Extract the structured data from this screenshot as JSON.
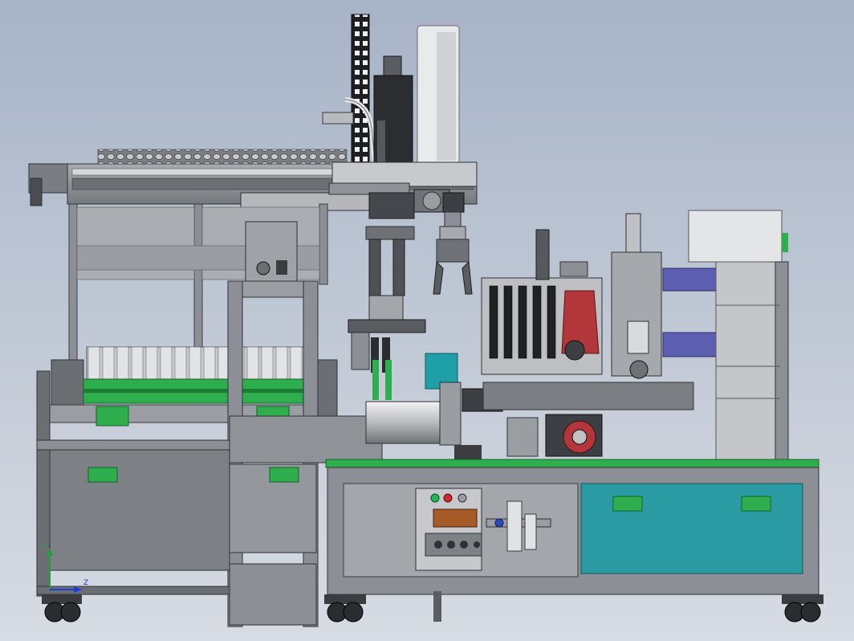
{
  "triad": {
    "x_axis_label": "Z",
    "y_axis_label": "Y"
  },
  "colors": {
    "background_top": "#a7b3c7",
    "background_bottom": "#d7dce3",
    "frame_gray": "#8c9096",
    "frame_dark": "#4a4d52",
    "panel_gray": "#9a9da1",
    "accent_green": "#2fae4e",
    "accent_teal": "#1fa0a8",
    "guard_teal": "#2a9aa3",
    "product_red": "#b2363a",
    "motor_blue": "#5c5fb0",
    "lamp_green": "#1db954",
    "lamp_red": "#d22a2a"
  },
  "components": [
    "overhead-gantry-linear-module",
    "vertical-cable-drag-chain",
    "vertical-servo-axis",
    "cylinder-gripper-head",
    "pneumatic-finger-gripper",
    "product-storage-conveyor",
    "vertical-lift-frame",
    "spindle-wrapping-station",
    "electrical-control-panel",
    "air-filter-regulator",
    "equipment-control-box",
    "main-worktable-cabinet",
    "caster-wheels"
  ]
}
